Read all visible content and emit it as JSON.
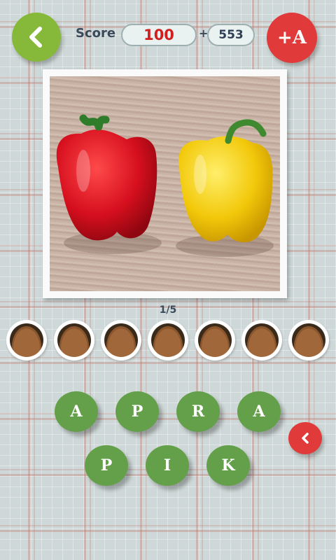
{
  "header": {
    "score_label": "Score",
    "score_value": "100",
    "plus_sign": "+",
    "coins_value": "553",
    "hint_label": "+A"
  },
  "puzzle": {
    "progress": "1/5",
    "answer_slot_count": 7,
    "letter_tiles": [
      "A",
      "P",
      "R",
      "A",
      "P",
      "I",
      "K"
    ]
  },
  "colors": {
    "back_button": "#86b83a",
    "hint_button": "#e03a3a",
    "tile": "#64a04a",
    "score_text": "#d11f1f"
  },
  "icons": {
    "back": "chevron-left-icon",
    "delete": "chevron-left-icon"
  }
}
